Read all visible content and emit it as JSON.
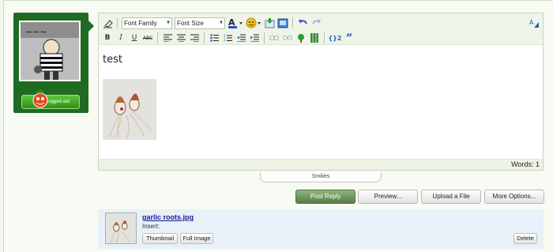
{
  "user": {
    "status_label": "Logged out"
  },
  "toolbar": {
    "font_family": "Font Family",
    "font_size": "Font Size",
    "icons_row1": [
      "eraser-icon",
      "font-family-select",
      "font-size-select",
      "text-color-icon",
      "smiley-icon",
      "insert-image-icon",
      "insert-media-icon",
      "undo-icon",
      "redo-icon",
      "resize-icon"
    ],
    "icons_row2": [
      "bold",
      "italic",
      "underline",
      "strike",
      "align-left",
      "align-center",
      "align-right",
      "bullet-list",
      "number-list",
      "outdent",
      "indent",
      "link",
      "unlink",
      "emoticon",
      "spoiler",
      "code",
      "quote"
    ]
  },
  "editor": {
    "text": "test",
    "word_count_label": "Words: 1"
  },
  "smilies_label": "Smilies",
  "buttons": {
    "post_reply": "Post Reply",
    "preview": "Preview...",
    "upload": "Upload a File",
    "more_options": "More Options..."
  },
  "attachment": {
    "filename": "garlic roots.jpg",
    "insert_label": "Insert:",
    "thumbnail_btn": "Thumbnail",
    "full_btn": "Full Image",
    "delete_btn": "Delete"
  },
  "colors": {
    "sidebar": "#1f6b22",
    "primary_button": "#6f9a5f",
    "page_bg": "#f2f7ec"
  }
}
